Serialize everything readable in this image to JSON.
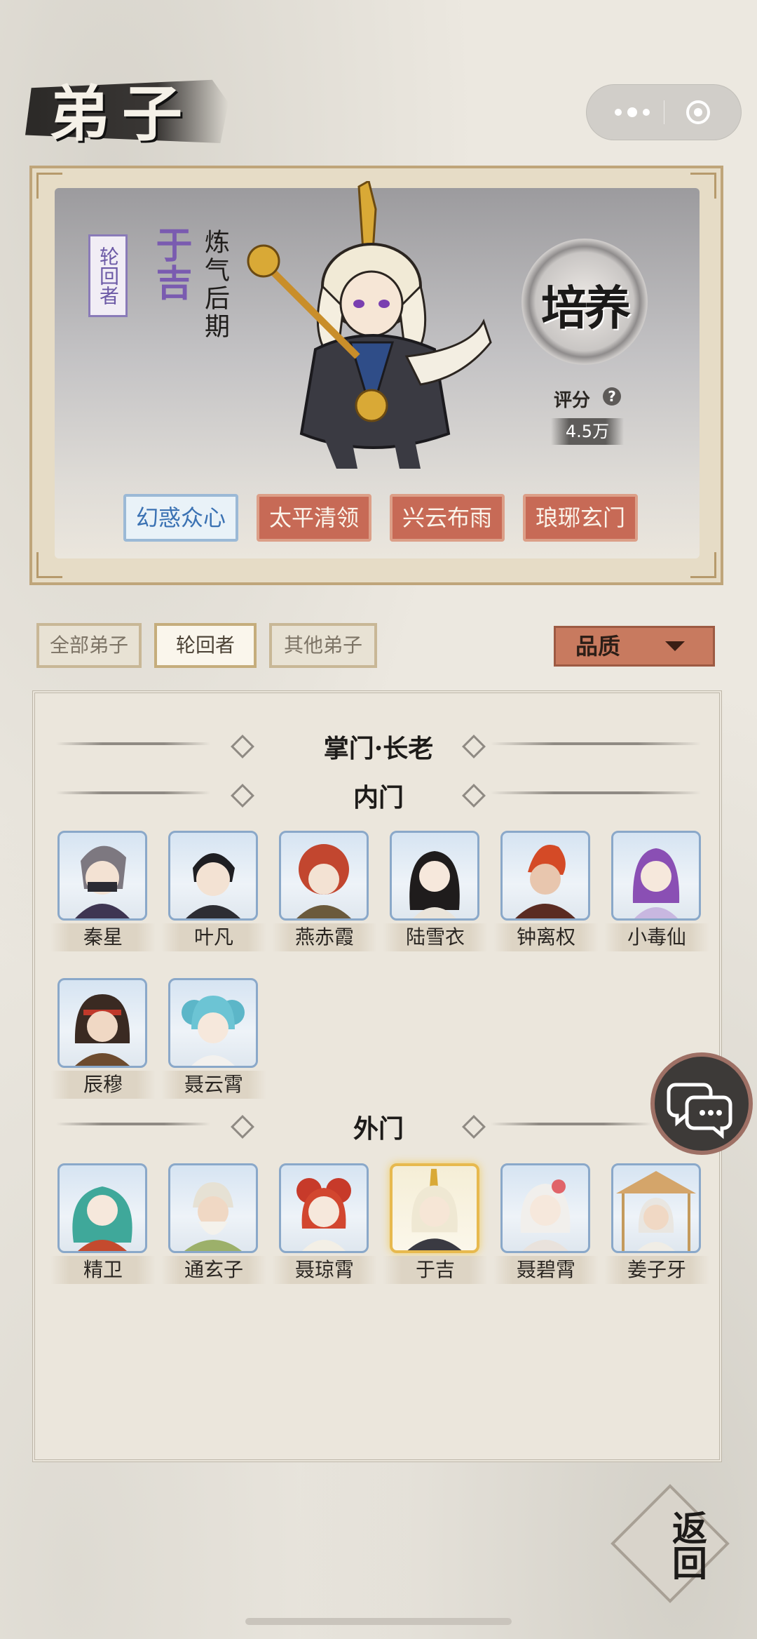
{
  "header": {
    "title": "弟子"
  },
  "hero": {
    "rank_seal": "轮回者",
    "name": "于吉",
    "realm": "炼气后期",
    "cultivate_label": "培养",
    "score_label": "评分",
    "score_value": "4.5万",
    "skills": [
      "幻惑众心",
      "太平清领",
      "兴云布雨",
      "琅琊玄门"
    ],
    "active_skill_index": 0
  },
  "filters": {
    "tabs": [
      "全部弟子",
      "轮回者",
      "其他弟子"
    ],
    "active_tab_index": 1,
    "sort_label": "品质"
  },
  "roster": {
    "section_leaders": "掌门·长老",
    "section_inner": "内门",
    "section_outer": "外门",
    "inner": [
      "秦星",
      "叶凡",
      "燕赤霞",
      "陆雪衣",
      "钟离权",
      "小毒仙",
      "辰穆",
      "聂云霄"
    ],
    "outer": [
      "精卫",
      "通玄子",
      "聂琼霄",
      "于吉",
      "聂碧霄",
      "姜子牙"
    ],
    "selected_outer_index": 3
  },
  "buttons": {
    "back": "返回"
  },
  "colors": {
    "skill_active": "#3b72b3",
    "skill_normal": "#c76a56",
    "name_purple": "#7a5bb0",
    "selected_gold": "#e7b94e"
  },
  "icons": [
    "more-dots-icon",
    "target-circle-icon",
    "help-icon",
    "chat-bubble-icon",
    "quality-caret-icon"
  ]
}
